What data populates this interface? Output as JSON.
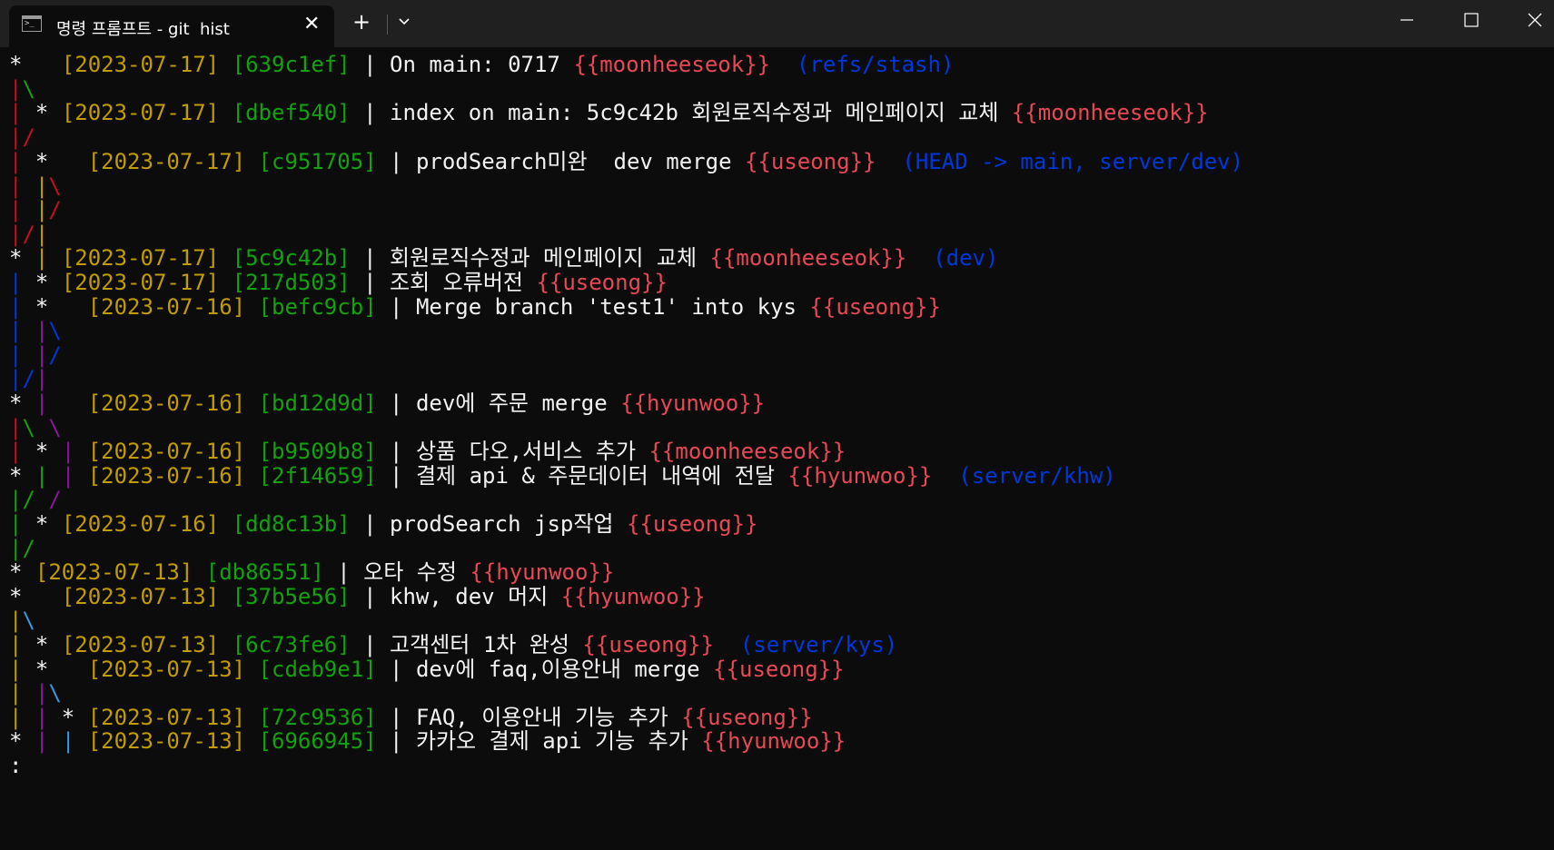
{
  "window": {
    "tab_title": "명령 프롬프트 - git  hist",
    "tab_icon": "cmd-icon",
    "close_tab_label": "✕",
    "new_tab_label": "+",
    "icons": {
      "minimize": "minimize-icon",
      "maximize": "maximize-icon",
      "close": "close-icon",
      "dropdown": "chevron-down-icon"
    }
  },
  "colors": {
    "background": "#0c0c0c",
    "date": "#c19c00",
    "hash": "#13a10e",
    "author": "#e74856",
    "refs": "#0037da",
    "graph_red": "#c50f1f",
    "graph_blue": "#0037da",
    "graph_magenta": "#881798",
    "graph_cyan": "#3a96dd"
  },
  "terminal": {
    "lines": [
      [
        [
          "w",
          "*   "
        ],
        [
          "y",
          "[2023-07-17]"
        ],
        [
          "w",
          " "
        ],
        [
          "g",
          "[639c1ef]"
        ],
        [
          "w",
          " | On main: 0717 "
        ],
        [
          "rd",
          "{{moonheeseok}}"
        ],
        [
          "w",
          "  "
        ],
        [
          "bl",
          "(refs/stash)"
        ]
      ],
      [
        [
          "r",
          "|"
        ],
        [
          "g",
          "\\"
        ]
      ],
      [
        [
          "r",
          "|"
        ],
        [
          "w",
          " * "
        ],
        [
          "y",
          "[2023-07-17]"
        ],
        [
          "w",
          " "
        ],
        [
          "g",
          "[dbef540]"
        ],
        [
          "w",
          " | index on main: 5c9c42b 회원로직수정과 메인페이지 교체 "
        ],
        [
          "rd",
          "{{moonheeseok}}"
        ]
      ],
      [
        [
          "r",
          "|/"
        ]
      ],
      [
        [
          "r",
          "|"
        ],
        [
          "w",
          " *   "
        ],
        [
          "y",
          "[2023-07-17]"
        ],
        [
          "w",
          " "
        ],
        [
          "g",
          "[c951705]"
        ],
        [
          "w",
          " | prodSearch미완  dev merge "
        ],
        [
          "rd",
          "{{useong}}"
        ],
        [
          "w",
          "  "
        ],
        [
          "bl",
          "(HEAD -> main, server/dev)"
        ]
      ],
      [
        [
          "r",
          "|"
        ],
        [
          "w",
          " "
        ],
        [
          "y",
          "|"
        ],
        [
          "r",
          "\\"
        ]
      ],
      [
        [
          "r",
          "|"
        ],
        [
          "w",
          " "
        ],
        [
          "y",
          "|"
        ],
        [
          "r",
          "/"
        ]
      ],
      [
        [
          "r",
          "|/"
        ],
        [
          "y",
          "|"
        ]
      ],
      [
        [
          "w",
          "* "
        ],
        [
          "y",
          "|"
        ],
        [
          "w",
          " "
        ],
        [
          "y",
          "[2023-07-17]"
        ],
        [
          "w",
          " "
        ],
        [
          "g",
          "[5c9c42b]"
        ],
        [
          "w",
          " | 회원로직수정과 메인페이지 교체 "
        ],
        [
          "rd",
          "{{moonheeseok}}"
        ],
        [
          "w",
          "  "
        ],
        [
          "bl",
          "(dev)"
        ]
      ],
      [
        [
          "b",
          "|"
        ],
        [
          "w",
          " * "
        ],
        [
          "y",
          "[2023-07-17]"
        ],
        [
          "w",
          " "
        ],
        [
          "g",
          "[217d503]"
        ],
        [
          "w",
          " | 조회 오류버전 "
        ],
        [
          "rd",
          "{{useong}}"
        ]
      ],
      [
        [
          "b",
          "|"
        ],
        [
          "w",
          " *   "
        ],
        [
          "y",
          "[2023-07-16]"
        ],
        [
          "w",
          " "
        ],
        [
          "g",
          "[befc9cb]"
        ],
        [
          "w",
          " | Merge branch 'test1' into kys "
        ],
        [
          "rd",
          "{{useong}}"
        ]
      ],
      [
        [
          "b",
          "|"
        ],
        [
          "w",
          " "
        ],
        [
          "m",
          "|"
        ],
        [
          "b",
          "\\"
        ]
      ],
      [
        [
          "b",
          "|"
        ],
        [
          "w",
          " "
        ],
        [
          "m",
          "|"
        ],
        [
          "b",
          "/"
        ]
      ],
      [
        [
          "b",
          "|/"
        ],
        [
          "m",
          "|"
        ]
      ],
      [
        [
          "w",
          "* "
        ],
        [
          "m",
          "|"
        ],
        [
          "w",
          "   "
        ],
        [
          "y",
          "[2023-07-16]"
        ],
        [
          "w",
          " "
        ],
        [
          "g",
          "[bd12d9d]"
        ],
        [
          "w",
          " | dev에 주문 merge "
        ],
        [
          "rd",
          "{{hyunwoo}}"
        ]
      ],
      [
        [
          "r",
          "|"
        ],
        [
          "g",
          "\\"
        ],
        [
          "w",
          " "
        ],
        [
          "m",
          "\\"
        ]
      ],
      [
        [
          "r",
          "|"
        ],
        [
          "w",
          " * "
        ],
        [
          "m",
          "|"
        ],
        [
          "w",
          " "
        ],
        [
          "y",
          "[2023-07-16]"
        ],
        [
          "w",
          " "
        ],
        [
          "g",
          "[b9509b8]"
        ],
        [
          "w",
          " | 상품 다오,서비스 추가 "
        ],
        [
          "rd",
          "{{moonheeseok}}"
        ]
      ],
      [
        [
          "w",
          "* "
        ],
        [
          "g",
          "|"
        ],
        [
          "w",
          " "
        ],
        [
          "m",
          "|"
        ],
        [
          "w",
          " "
        ],
        [
          "y",
          "[2023-07-16]"
        ],
        [
          "w",
          " "
        ],
        [
          "g",
          "[2f14659]"
        ],
        [
          "w",
          " | 결제 api & 주문데이터 내역에 전달 "
        ],
        [
          "rd",
          "{{hyunwoo}}"
        ],
        [
          "w",
          "  "
        ],
        [
          "bl",
          "(server/khw)"
        ]
      ],
      [
        [
          "g",
          "|/"
        ],
        [
          "w",
          " "
        ],
        [
          "m",
          "/"
        ]
      ],
      [
        [
          "g",
          "|"
        ],
        [
          "w",
          " * "
        ],
        [
          "y",
          "[2023-07-16]"
        ],
        [
          "w",
          " "
        ],
        [
          "g",
          "[dd8c13b]"
        ],
        [
          "w",
          " | prodSearch jsp작업 "
        ],
        [
          "rd",
          "{{useong}}"
        ]
      ],
      [
        [
          "g",
          "|/"
        ]
      ],
      [
        [
          "w",
          "* "
        ],
        [
          "y",
          "[2023-07-13]"
        ],
        [
          "w",
          " "
        ],
        [
          "g",
          "[db86551]"
        ],
        [
          "w",
          " | 오타 수정 "
        ],
        [
          "rd",
          "{{hyunwoo}}"
        ]
      ],
      [
        [
          "w",
          "*   "
        ],
        [
          "y",
          "[2023-07-13]"
        ],
        [
          "w",
          " "
        ],
        [
          "g",
          "[37b5e56]"
        ],
        [
          "w",
          " | khw, dev 머지 "
        ],
        [
          "rd",
          "{{hyunwoo}}"
        ]
      ],
      [
        [
          "y",
          "|"
        ],
        [
          "c",
          "\\"
        ]
      ],
      [
        [
          "y",
          "|"
        ],
        [
          "w",
          " * "
        ],
        [
          "y",
          "[2023-07-13]"
        ],
        [
          "w",
          " "
        ],
        [
          "g",
          "[6c73fe6]"
        ],
        [
          "w",
          " | 고객센터 1차 완성 "
        ],
        [
          "rd",
          "{{useong}}"
        ],
        [
          "w",
          "  "
        ],
        [
          "bl",
          "(server/kys)"
        ]
      ],
      [
        [
          "y",
          "|"
        ],
        [
          "w",
          " *   "
        ],
        [
          "y",
          "[2023-07-13]"
        ],
        [
          "w",
          " "
        ],
        [
          "g",
          "[cdeb9e1]"
        ],
        [
          "w",
          " | dev에 faq,이용안내 merge "
        ],
        [
          "rd",
          "{{useong}}"
        ]
      ],
      [
        [
          "y",
          "|"
        ],
        [
          "w",
          " "
        ],
        [
          "m",
          "|"
        ],
        [
          "c",
          "\\"
        ]
      ],
      [
        [
          "y",
          "|"
        ],
        [
          "w",
          " "
        ],
        [
          "m",
          "|"
        ],
        [
          "w",
          " * "
        ],
        [
          "y",
          "[2023-07-13]"
        ],
        [
          "w",
          " "
        ],
        [
          "g",
          "[72c9536]"
        ],
        [
          "w",
          " | FAQ, 이용안내 기능 추가 "
        ],
        [
          "rd",
          "{{useong}}"
        ]
      ],
      [
        [
          "w",
          "* "
        ],
        [
          "m",
          "|"
        ],
        [
          "w",
          " "
        ],
        [
          "c",
          "|"
        ],
        [
          "w",
          " "
        ],
        [
          "y",
          "[2023-07-13]"
        ],
        [
          "w",
          " "
        ],
        [
          "g",
          "[6966945]"
        ],
        [
          "w",
          " | 카카오 결제 api 기능 추가 "
        ],
        [
          "rd",
          "{{hyunwoo}}"
        ]
      ],
      [
        [
          "w",
          ":"
        ]
      ]
    ]
  }
}
